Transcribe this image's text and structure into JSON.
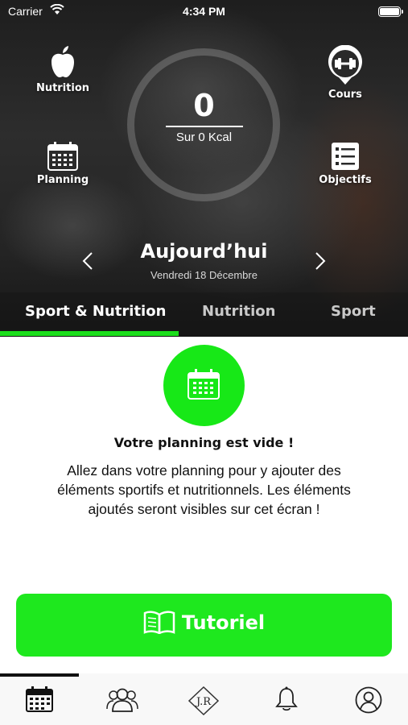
{
  "status_bar": {
    "carrier": "Carrier",
    "time": "4:34 PM"
  },
  "hero": {
    "shortcuts": [
      {
        "id": "nutrition",
        "label": "Nutrition",
        "icon": "apple-icon"
      },
      {
        "id": "cours",
        "label": "Cours",
        "icon": "dumbbell-pin-icon"
      },
      {
        "id": "planning",
        "label": "Planning",
        "icon": "calendar-icon"
      },
      {
        "id": "objectifs",
        "label": "Objectifs",
        "icon": "checklist-icon"
      }
    ],
    "kcal_value": "0",
    "kcal_label": "Sur 0 Kcal",
    "date_title": "Aujourd’hui",
    "date_subtitle": "Vendredi 18 Décembre"
  },
  "tabs": [
    {
      "label": "Sport & Nutrition",
      "active": true
    },
    {
      "label": "Nutrition",
      "active": false
    },
    {
      "label": "Sport",
      "active": false
    }
  ],
  "empty_state": {
    "icon": "calendar-icon",
    "title": "Votre planning est vide !",
    "description": "Allez dans votre planning pour y ajouter des éléments sportifs et nutritionnels. Les éléments ajoutés seront visibles sur cet écran !"
  },
  "tutorial_button": {
    "label": "Tutoriel",
    "icon": "open-book-icon"
  },
  "bottom_nav": {
    "items": [
      {
        "id": "planning",
        "icon": "calendar-icon",
        "active": true
      },
      {
        "id": "community",
        "icon": "group-icon",
        "active": false
      },
      {
        "id": "coach",
        "icon": "coach-logo-icon",
        "logo_text": "J.R",
        "active": false
      },
      {
        "id": "notifications",
        "icon": "bell-icon",
        "active": false
      },
      {
        "id": "profile",
        "icon": "user-icon",
        "active": false
      }
    ]
  },
  "colors": {
    "accent": "#1ee81e",
    "hero_bg": "#242424",
    "text_dark": "#111111"
  }
}
